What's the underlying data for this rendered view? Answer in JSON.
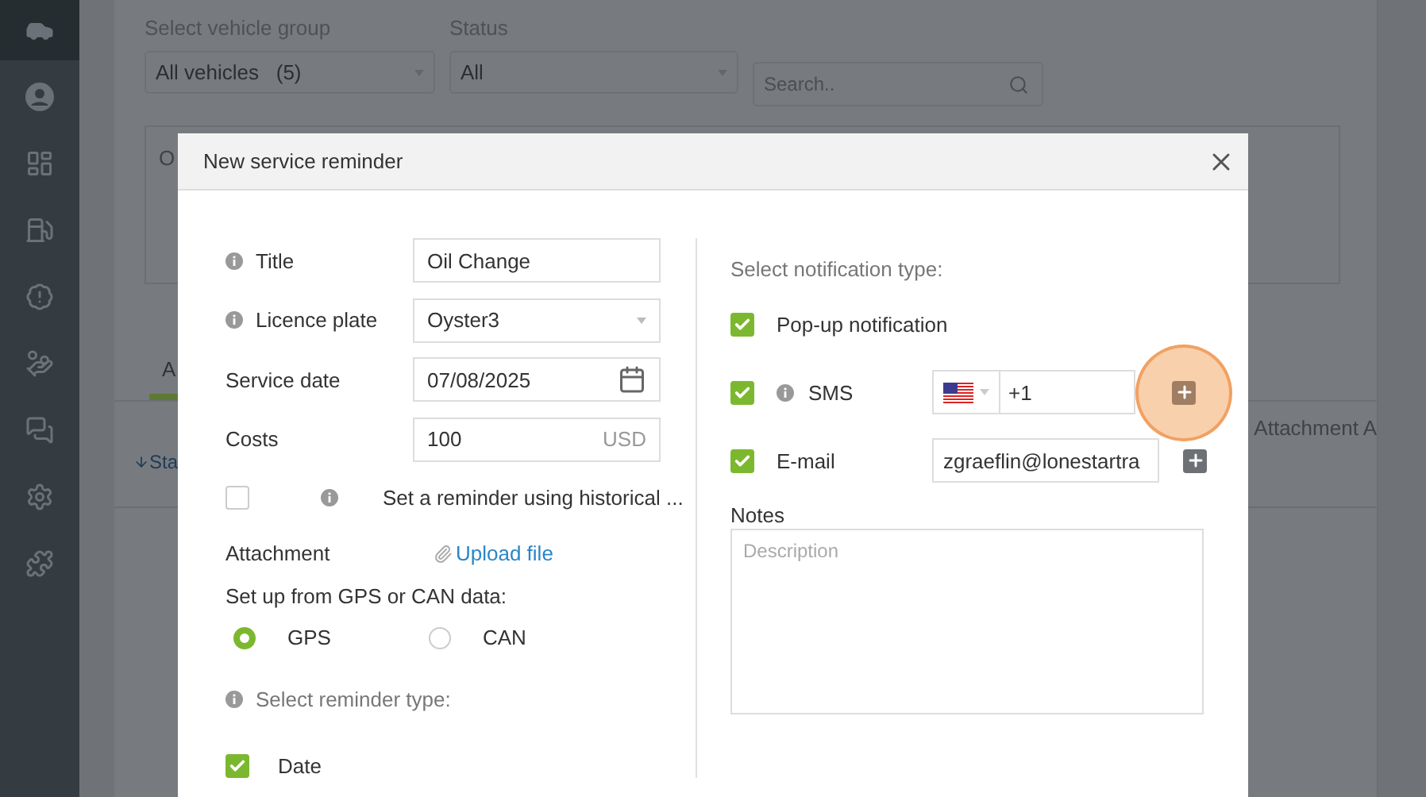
{
  "sidebar": {
    "items": [
      {
        "selected": true
      },
      {
        "selected": false
      },
      {
        "selected": false
      },
      {
        "selected": false
      },
      {
        "selected": false
      },
      {
        "selected": false
      },
      {
        "selected": false
      },
      {
        "selected": false
      },
      {
        "selected": false
      }
    ]
  },
  "filters": {
    "vehicle_group": {
      "label": "Select vehicle group",
      "value": "All vehicles   (5)"
    },
    "status": {
      "label": "Status",
      "value": "All"
    },
    "search": {
      "placeholder": "Search.."
    }
  },
  "background": {
    "card_label": "O",
    "tab": "A",
    "column_1": "Sta",
    "column_last": "Attachment A"
  },
  "modal": {
    "title": "New service reminder",
    "fields": [
      {
        "kind": "text",
        "label": "Title",
        "info": true,
        "value": "Oil Change"
      },
      {
        "kind": "select",
        "label": "Licence plate",
        "info": true,
        "value": "Oyster3"
      },
      {
        "kind": "date",
        "label": "Service date",
        "info": false,
        "value": "07/08/2025"
      },
      {
        "kind": "money",
        "label": "Costs",
        "info": false,
        "value": "100",
        "suffix": "USD"
      }
    ],
    "historical": {
      "label": "Set a reminder using historical ...",
      "checked": false
    },
    "attachment": {
      "label": "Attachment",
      "link": "Upload file"
    },
    "source": {
      "label": "Set up from GPS or CAN data:",
      "options": [
        {
          "label": "GPS",
          "selected": true
        },
        {
          "label": "CAN",
          "selected": false
        }
      ]
    },
    "reminder_type_label": "Select reminder type:",
    "reminder_types": [
      {
        "label": "Date",
        "checked": true
      }
    ],
    "notification_label": "Select notification type:",
    "notifications": [
      {
        "kind": "popup",
        "label": "Pop-up notification",
        "checked": true
      },
      {
        "kind": "sms",
        "label": "SMS",
        "checked": true,
        "value": "+1",
        "highlighted": true
      },
      {
        "kind": "email",
        "label": "E-mail",
        "checked": true,
        "value": "zgraeflin@lonestartra",
        "highlighted": false
      }
    ],
    "notes": {
      "label": "Notes",
      "placeholder": "Description"
    }
  }
}
